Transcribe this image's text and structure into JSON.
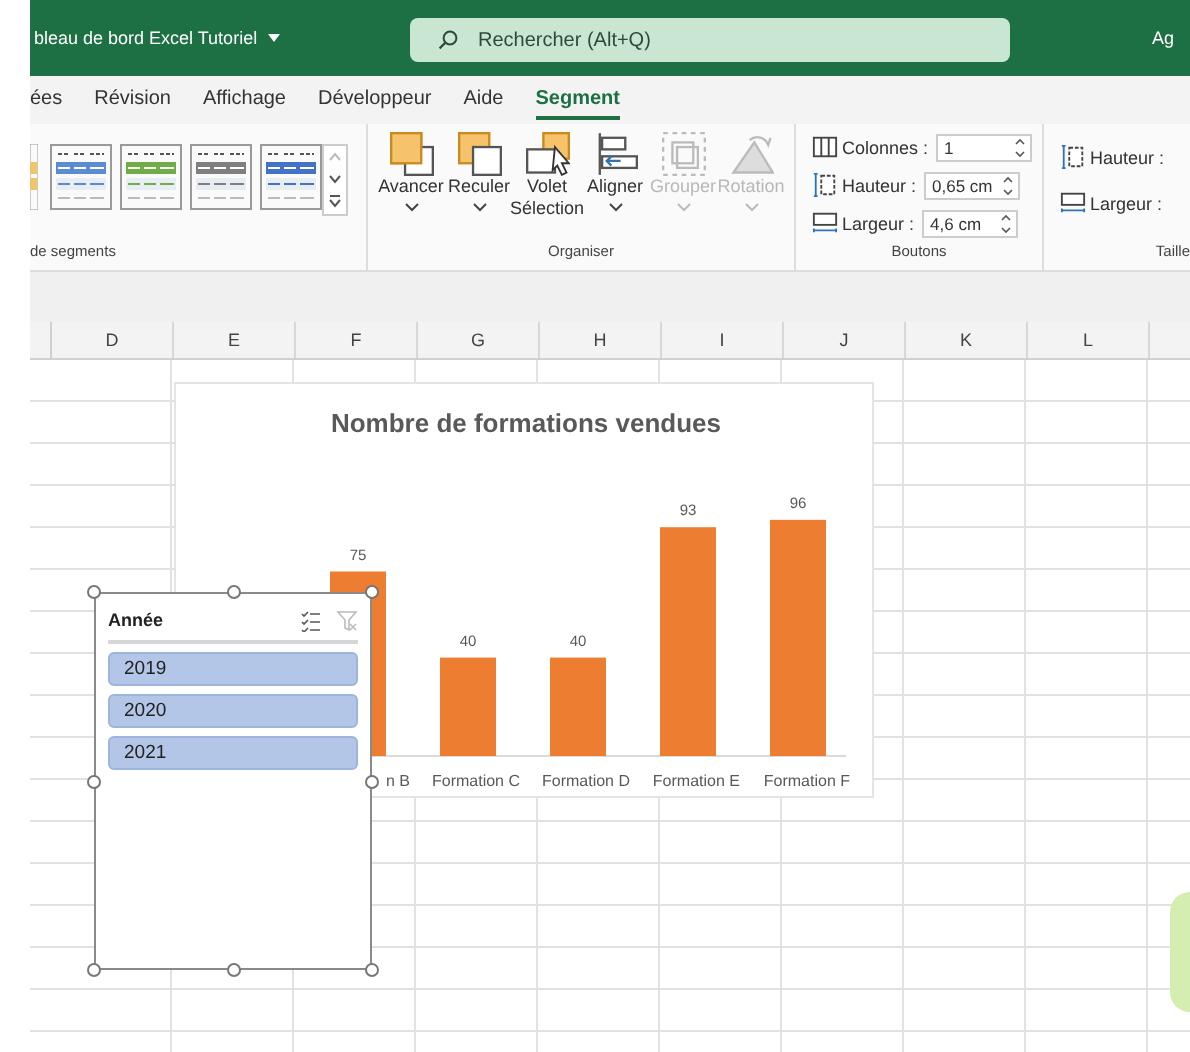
{
  "title_bar": {
    "document_title": "bleau de bord Excel Tutoriel",
    "search": {
      "placeholder": "Rechercher (Alt+Q)"
    },
    "user": "Ag"
  },
  "tabs": [
    {
      "label": "ées",
      "selected": false
    },
    {
      "label": "Révision",
      "selected": false
    },
    {
      "label": "Affichage",
      "selected": false
    },
    {
      "label": "Développeur",
      "selected": false
    },
    {
      "label": "Aide",
      "selected": false
    },
    {
      "label": "Segment",
      "selected": true
    }
  ],
  "ribbon": {
    "styles_group": {
      "label": "de segments",
      "styles": [
        {
          "color": "#f2c46d"
        },
        {
          "color": "#5b8bd0"
        },
        {
          "color": "#70ad47"
        },
        {
          "color": "#7f7f7f"
        },
        {
          "color": "#4472c4"
        }
      ]
    },
    "organiser_group": {
      "label": "Organiser",
      "buttons": [
        {
          "kind": "forward",
          "label": "Avancer",
          "dropdown": true,
          "disabled": false
        },
        {
          "kind": "backward",
          "label": "Reculer",
          "dropdown": true,
          "disabled": false
        },
        {
          "kind": "pane",
          "label": "Volet Sélection",
          "dropdown": false,
          "disabled": false
        },
        {
          "kind": "align",
          "label": "Aligner",
          "dropdown": true,
          "disabled": false
        },
        {
          "kind": "group",
          "label": "Grouper",
          "dropdown": true,
          "disabled": true
        },
        {
          "kind": "rotate",
          "label": "Rotation",
          "dropdown": true,
          "disabled": true
        }
      ]
    },
    "buttons_group": {
      "label": "Boutons",
      "fields": [
        {
          "kind": "columns",
          "label": "Colonnes :",
          "value": "1"
        },
        {
          "kind": "height",
          "label": "Hauteur :",
          "value": "0,65 cm"
        },
        {
          "kind": "width",
          "label": "Largeur :",
          "value": "4,6 cm"
        }
      ]
    },
    "size_group": {
      "label": "Taille",
      "fields": [
        {
          "kind": "height",
          "label": "Hauteur :"
        },
        {
          "kind": "width",
          "label": "Largeur :"
        }
      ]
    }
  },
  "sheet": {
    "columns": [
      "D",
      "E",
      "F",
      "G",
      "H",
      "I",
      "J",
      "K",
      "L"
    ],
    "chart": {
      "chart_data": {
        "type": "bar",
        "title": "Nombre de formations vendues",
        "categories": [
          "n B",
          "Formation C",
          "Formation D",
          "Formation E",
          "Formation F"
        ],
        "values": [
          75,
          40,
          40,
          93,
          96
        ],
        "data_labels": true
      }
    },
    "slicer": {
      "title": "Année",
      "clear_filter_disabled": true,
      "items": [
        {
          "label": "2019",
          "selected": true
        },
        {
          "label": "2020",
          "selected": true
        },
        {
          "label": "2021",
          "selected": true
        }
      ]
    }
  }
}
